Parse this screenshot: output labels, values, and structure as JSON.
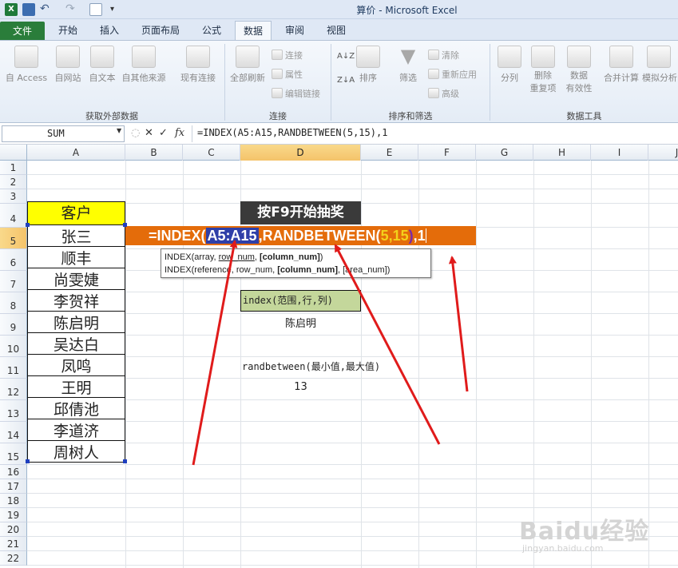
{
  "window": {
    "title": "算价 - Microsoft Excel"
  },
  "tabs": [
    "文件",
    "开始",
    "插入",
    "页面布局",
    "公式",
    "数据",
    "审阅",
    "视图"
  ],
  "active_tab": "数据",
  "ribbon": {
    "get_external": {
      "buttons": [
        "自 Access",
        "自网站",
        "自文本",
        "自其他来源",
        "现有连接"
      ],
      "label": "获取外部数据"
    },
    "connections": {
      "big": "全部刷新",
      "small": [
        "连接",
        "属性",
        "编辑链接"
      ],
      "label": "连接"
    },
    "sort_filter": {
      "big": [
        "排序",
        "筛选"
      ],
      "small": [
        "清除",
        "重新应用",
        "高级"
      ],
      "label": "排序和筛选"
    },
    "data_tools": {
      "buttons": [
        "分列",
        "删除\n重复项",
        "数据\n有效性",
        "合并计算",
        "模拟分析"
      ],
      "label": "数据工具"
    }
  },
  "formula_bar": {
    "name_box": "SUM",
    "formula": "=INDEX(A5:A15,RANDBETWEEN(5,15),1"
  },
  "columns": [
    "A",
    "B",
    "C",
    "D",
    "E",
    "F",
    "G",
    "H",
    "I",
    "J"
  ],
  "rows": [
    "1",
    "2",
    "3",
    "4",
    "5",
    "6",
    "7",
    "8",
    "9",
    "10",
    "11",
    "12",
    "13",
    "14",
    "15",
    "16",
    "17",
    "18",
    "19",
    "20",
    "21",
    "22"
  ],
  "cells": {
    "A4": "客户",
    "customers": [
      "张三",
      "顺丰",
      "尚雯婕",
      "李贺祥",
      "陈启明",
      "吴达白",
      "凤鸣",
      "王明",
      "邱倩池",
      "李道济",
      "周树人"
    ],
    "D4": "按F9开始抽奖",
    "D8": "index(范围,行,列)",
    "D9": "陈启明",
    "D11": "randbetween(最小值,最大值)",
    "D12": "13"
  },
  "edit_tokens": [
    {
      "t": "=INDEX(",
      "c": "w"
    },
    {
      "t": "A5:A15",
      "c": "ref"
    },
    {
      "t": ",RANDBETWEEN(",
      "c": "w"
    },
    {
      "t": "5,15",
      "c": "y"
    },
    {
      "t": ")",
      "c": "p"
    },
    {
      "t": ",1",
      "c": "w"
    }
  ],
  "tooltip": {
    "line1": {
      "pre": "INDEX(array, ",
      "link": "row_num",
      "mid": ", ",
      "bold": "[column_num]",
      "post": ")"
    },
    "line2": {
      "pre": "INDEX(reference, row_num, ",
      "bold": "[column_num]",
      "post": ", [area_num])"
    }
  },
  "watermark": {
    "main": "Baidu经验",
    "sub": "jingyan.baidu.com"
  },
  "colors": {
    "accent_orange": "#e46c0a",
    "header_yellow": "#ffff00",
    "hint_green": "#c4d79b",
    "arrow_red": "#e01b1b"
  }
}
